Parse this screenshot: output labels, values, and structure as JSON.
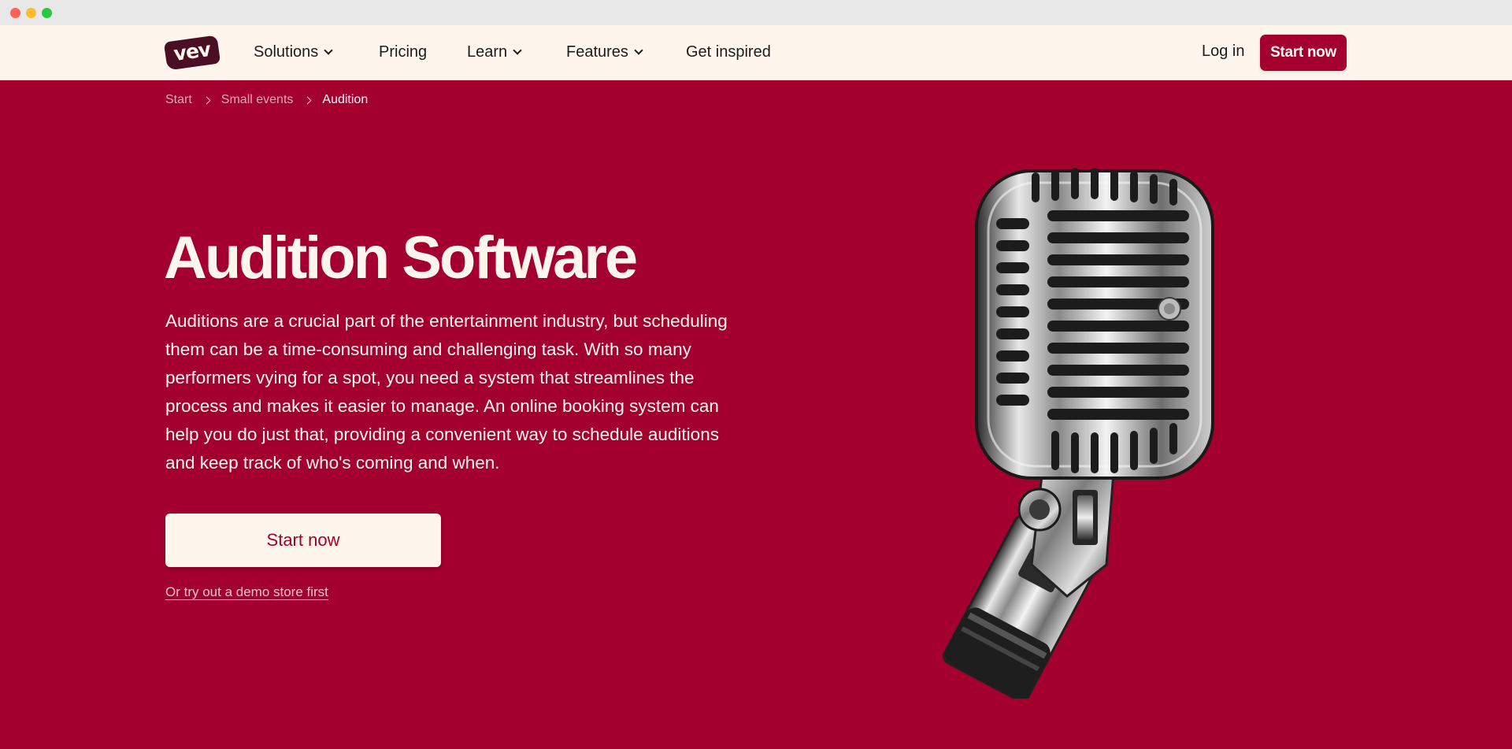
{
  "window": {
    "controls": [
      "close",
      "minimize",
      "maximize"
    ]
  },
  "nav": {
    "logo": "vev",
    "items": [
      {
        "label": "Solutions",
        "dropdown": true
      },
      {
        "label": "Pricing",
        "dropdown": false
      },
      {
        "label": "Learn",
        "dropdown": true
      },
      {
        "label": "Features",
        "dropdown": true
      },
      {
        "label": "Get inspired",
        "dropdown": false
      }
    ],
    "login": "Log in",
    "cta": "Start now"
  },
  "breadcrumb": [
    "Start",
    "Small events",
    "Audition"
  ],
  "hero": {
    "title": "Audition Software",
    "description": "Auditions are a crucial part of the entertainment industry, but scheduling them can be a time-consuming and challenging task. With so many performers vying for a spot, you need a system that streamlines the process and makes it easier to manage. An online booking system can help you do just that, providing a convenient way to schedule auditions and keep track of who's coming and when.",
    "cta": "Start now",
    "demo_link": "Or try out a demo store first",
    "image": "vintage-microphone"
  },
  "colors": {
    "brand": "#a30030",
    "cream": "#fef6ec",
    "logo_bg": "#4a0f22",
    "text_dark": "#1c1c1c"
  }
}
